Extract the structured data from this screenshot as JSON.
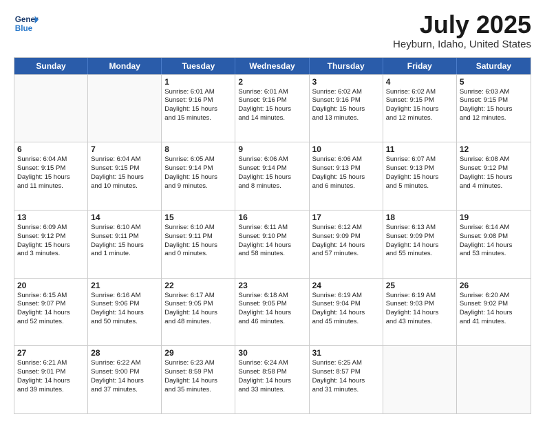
{
  "header": {
    "logo_line1": "General",
    "logo_line2": "Blue",
    "main_title": "July 2025",
    "subtitle": "Heyburn, Idaho, United States"
  },
  "days_of_week": [
    "Sunday",
    "Monday",
    "Tuesday",
    "Wednesday",
    "Thursday",
    "Friday",
    "Saturday"
  ],
  "weeks": [
    [
      {
        "day": "",
        "empty": true
      },
      {
        "day": "",
        "empty": true
      },
      {
        "day": "1",
        "lines": [
          "Sunrise: 6:01 AM",
          "Sunset: 9:16 PM",
          "Daylight: 15 hours",
          "and 15 minutes."
        ]
      },
      {
        "day": "2",
        "lines": [
          "Sunrise: 6:01 AM",
          "Sunset: 9:16 PM",
          "Daylight: 15 hours",
          "and 14 minutes."
        ]
      },
      {
        "day": "3",
        "lines": [
          "Sunrise: 6:02 AM",
          "Sunset: 9:16 PM",
          "Daylight: 15 hours",
          "and 13 minutes."
        ]
      },
      {
        "day": "4",
        "lines": [
          "Sunrise: 6:02 AM",
          "Sunset: 9:15 PM",
          "Daylight: 15 hours",
          "and 12 minutes."
        ]
      },
      {
        "day": "5",
        "lines": [
          "Sunrise: 6:03 AM",
          "Sunset: 9:15 PM",
          "Daylight: 15 hours",
          "and 12 minutes."
        ]
      }
    ],
    [
      {
        "day": "6",
        "lines": [
          "Sunrise: 6:04 AM",
          "Sunset: 9:15 PM",
          "Daylight: 15 hours",
          "and 11 minutes."
        ]
      },
      {
        "day": "7",
        "lines": [
          "Sunrise: 6:04 AM",
          "Sunset: 9:15 PM",
          "Daylight: 15 hours",
          "and 10 minutes."
        ]
      },
      {
        "day": "8",
        "lines": [
          "Sunrise: 6:05 AM",
          "Sunset: 9:14 PM",
          "Daylight: 15 hours",
          "and 9 minutes."
        ]
      },
      {
        "day": "9",
        "lines": [
          "Sunrise: 6:06 AM",
          "Sunset: 9:14 PM",
          "Daylight: 15 hours",
          "and 8 minutes."
        ]
      },
      {
        "day": "10",
        "lines": [
          "Sunrise: 6:06 AM",
          "Sunset: 9:13 PM",
          "Daylight: 15 hours",
          "and 6 minutes."
        ]
      },
      {
        "day": "11",
        "lines": [
          "Sunrise: 6:07 AM",
          "Sunset: 9:13 PM",
          "Daylight: 15 hours",
          "and 5 minutes."
        ]
      },
      {
        "day": "12",
        "lines": [
          "Sunrise: 6:08 AM",
          "Sunset: 9:12 PM",
          "Daylight: 15 hours",
          "and 4 minutes."
        ]
      }
    ],
    [
      {
        "day": "13",
        "lines": [
          "Sunrise: 6:09 AM",
          "Sunset: 9:12 PM",
          "Daylight: 15 hours",
          "and 3 minutes."
        ]
      },
      {
        "day": "14",
        "lines": [
          "Sunrise: 6:10 AM",
          "Sunset: 9:11 PM",
          "Daylight: 15 hours",
          "and 1 minute."
        ]
      },
      {
        "day": "15",
        "lines": [
          "Sunrise: 6:10 AM",
          "Sunset: 9:11 PM",
          "Daylight: 15 hours",
          "and 0 minutes."
        ]
      },
      {
        "day": "16",
        "lines": [
          "Sunrise: 6:11 AM",
          "Sunset: 9:10 PM",
          "Daylight: 14 hours",
          "and 58 minutes."
        ]
      },
      {
        "day": "17",
        "lines": [
          "Sunrise: 6:12 AM",
          "Sunset: 9:09 PM",
          "Daylight: 14 hours",
          "and 57 minutes."
        ]
      },
      {
        "day": "18",
        "lines": [
          "Sunrise: 6:13 AM",
          "Sunset: 9:09 PM",
          "Daylight: 14 hours",
          "and 55 minutes."
        ]
      },
      {
        "day": "19",
        "lines": [
          "Sunrise: 6:14 AM",
          "Sunset: 9:08 PM",
          "Daylight: 14 hours",
          "and 53 minutes."
        ]
      }
    ],
    [
      {
        "day": "20",
        "lines": [
          "Sunrise: 6:15 AM",
          "Sunset: 9:07 PM",
          "Daylight: 14 hours",
          "and 52 minutes."
        ]
      },
      {
        "day": "21",
        "lines": [
          "Sunrise: 6:16 AM",
          "Sunset: 9:06 PM",
          "Daylight: 14 hours",
          "and 50 minutes."
        ]
      },
      {
        "day": "22",
        "lines": [
          "Sunrise: 6:17 AM",
          "Sunset: 9:05 PM",
          "Daylight: 14 hours",
          "and 48 minutes."
        ]
      },
      {
        "day": "23",
        "lines": [
          "Sunrise: 6:18 AM",
          "Sunset: 9:05 PM",
          "Daylight: 14 hours",
          "and 46 minutes."
        ]
      },
      {
        "day": "24",
        "lines": [
          "Sunrise: 6:19 AM",
          "Sunset: 9:04 PM",
          "Daylight: 14 hours",
          "and 45 minutes."
        ]
      },
      {
        "day": "25",
        "lines": [
          "Sunrise: 6:19 AM",
          "Sunset: 9:03 PM",
          "Daylight: 14 hours",
          "and 43 minutes."
        ]
      },
      {
        "day": "26",
        "lines": [
          "Sunrise: 6:20 AM",
          "Sunset: 9:02 PM",
          "Daylight: 14 hours",
          "and 41 minutes."
        ]
      }
    ],
    [
      {
        "day": "27",
        "lines": [
          "Sunrise: 6:21 AM",
          "Sunset: 9:01 PM",
          "Daylight: 14 hours",
          "and 39 minutes."
        ]
      },
      {
        "day": "28",
        "lines": [
          "Sunrise: 6:22 AM",
          "Sunset: 9:00 PM",
          "Daylight: 14 hours",
          "and 37 minutes."
        ]
      },
      {
        "day": "29",
        "lines": [
          "Sunrise: 6:23 AM",
          "Sunset: 8:59 PM",
          "Daylight: 14 hours",
          "and 35 minutes."
        ]
      },
      {
        "day": "30",
        "lines": [
          "Sunrise: 6:24 AM",
          "Sunset: 8:58 PM",
          "Daylight: 14 hours",
          "and 33 minutes."
        ]
      },
      {
        "day": "31",
        "lines": [
          "Sunrise: 6:25 AM",
          "Sunset: 8:57 PM",
          "Daylight: 14 hours",
          "and 31 minutes."
        ]
      },
      {
        "day": "",
        "empty": true
      },
      {
        "day": "",
        "empty": true
      }
    ]
  ]
}
